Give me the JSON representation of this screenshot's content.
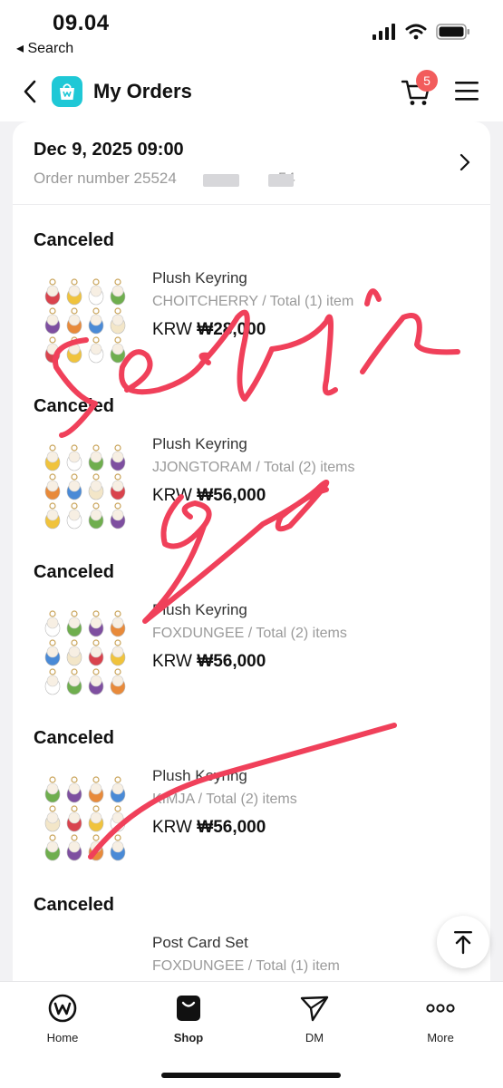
{
  "status_bar": {
    "time": "09.04",
    "back_app": "◂ Search"
  },
  "header": {
    "title": "My Orders",
    "cart_count": "5"
  },
  "order": {
    "date": "Dec 9, 2025 09:00",
    "number_prefix": "Order number 25524",
    "number_suffix": "54"
  },
  "items": [
    {
      "status": "Canceled",
      "name": "Plush Keyring",
      "meta": "CHOITCHERRY / Total (1) item",
      "currency": "KRW",
      "price": "₩28,000"
    },
    {
      "status": "Canceled",
      "name": "Plush Keyring",
      "meta": "JJONGTORAM / Total (2) items",
      "currency": "KRW",
      "price": "₩56,000"
    },
    {
      "status": "Canceled",
      "name": "Plush Keyring",
      "meta": "FOXDUNGEE / Total (2) items",
      "currency": "KRW",
      "price": "₩56,000"
    },
    {
      "status": "Canceled",
      "name": "Plush Keyring",
      "meta": "KIMJA / Total (2) items",
      "currency": "KRW",
      "price": "₩56,000"
    },
    {
      "status": "Canceled",
      "name": "Post Card Set",
      "meta": "FOXDUNGEE / Total (1) item",
      "currency": "",
      "price": ""
    }
  ],
  "nav": [
    {
      "label": "Home",
      "icon": "w-logo-icon"
    },
    {
      "label": "Shop",
      "icon": "shopping-bag-icon"
    },
    {
      "label": "DM",
      "icon": "send-icon"
    },
    {
      "label": "More",
      "icon": "more-dots-icon"
    }
  ],
  "colors": {
    "brand": "#1fc8d6",
    "badge": "#f25c5c",
    "scribble": "#f0405a"
  }
}
